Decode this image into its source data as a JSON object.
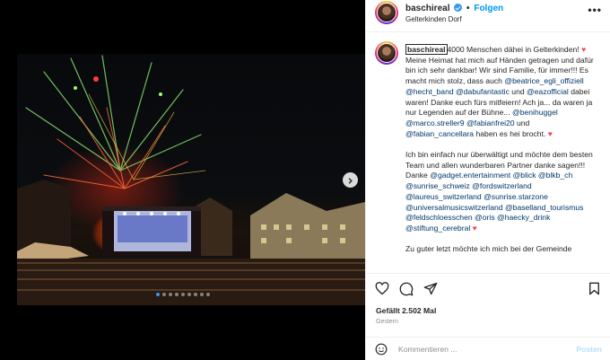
{
  "post": {
    "username": "baschireal",
    "separator": "•",
    "follow_label": "Folgen",
    "location": "Gelterkinden Dorf",
    "more_label": "•••"
  },
  "caption": {
    "username": "baschireal",
    "p1_a": "4000 Menschen dähei in Gelterkinden! ",
    "heart": "♥",
    "p1_b": " Meine Heimat hat mich auf Händen getragen und dafür bin ich sehr dankbar! Wir sind Familie, für immer!!! Es macht mich stolz, dass auch ",
    "m1": "@beatrice_egli_offiziell",
    "m2": "@hecht_band",
    "m3": "@dabufantastic",
    "and1": " und ",
    "m4": "@eazofficial",
    "p1_c": " dabei waren! Danke euch fürs mitfeiern! Ach ja... da waren ja nur Legenden auf der Bühne... ",
    "m5": "@benihuggel",
    "m6": "@marco.streller9",
    "m7": "@fabianfrei20",
    "and2": " und ",
    "m8": "@fabian_cancellara",
    "p1_d": " haben es hei brocht. ",
    "p2_a": "Ich bin einfach nur überwältigt und möchte dem besten Team und allen wunderbaren Partner danke sagen!!! Danke ",
    "m9": "@gadget.entertainment",
    "m10": "@blick",
    "m11": "@blkb_ch",
    "m12": "@sunrise_schweiz",
    "m13": "@fordswitzerland",
    "m14": "@laureus_switzerland",
    "m15": "@sunrise.starzone",
    "m16": "@universalmusicswitzerland",
    "m17": "@baselland_tourismus",
    "m18": "@feldschloesschen",
    "m19": "@oris",
    "m20": "@haecky_drink",
    "m21": "@stiftung_cerebral",
    "p3": "Zu guter letzt möchte ich mich bei der Gemeinde"
  },
  "engagement": {
    "likes": "Gefällt 2.502 Mal",
    "time": "Gestern"
  },
  "comment": {
    "placeholder": "Kommentieren ...",
    "post_label": "Posten"
  },
  "carousel": {
    "slide_count": 9,
    "active_index": 0
  },
  "colors": {
    "accent": "#0095f6",
    "verified": "#3897f0",
    "mention": "#00376b",
    "heart": "#ed4956"
  },
  "icons": [
    "chevron-right-icon",
    "more-icon",
    "verified-icon",
    "heart-icon",
    "comment-icon",
    "share-icon",
    "bookmark-icon",
    "emoji-icon"
  ]
}
